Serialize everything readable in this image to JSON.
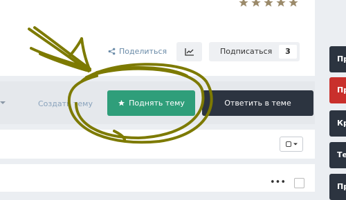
{
  "topic_header": {
    "rating_stars": 5,
    "share_label": "Поделиться",
    "subscribe_label": "Подписаться",
    "subscribe_count": "3"
  },
  "actions": {
    "create_topic_label": "Создать тему",
    "raise_topic_label": "Поднять тему",
    "reply_label": "Ответить в теме"
  },
  "sidebar_tabs": [
    {
      "label": "Пр",
      "color": "#2c3440"
    },
    {
      "label": "Пр",
      "color": "#c9302c"
    },
    {
      "label": "Кр",
      "color": "#2c3440"
    },
    {
      "label": "Те",
      "color": "#2c3440"
    },
    {
      "label": "Пр",
      "color": "#2c3440"
    }
  ],
  "colors": {
    "raise_button": "#2f9e7a",
    "reply_button": "#2c3440",
    "annotation_scribble": "#7d7a00",
    "star": "#9b8a6a"
  },
  "icons": {
    "share": "share-icon",
    "stats": "line-chart-icon",
    "raise": "star-icon",
    "more": "ellipsis-icon"
  }
}
